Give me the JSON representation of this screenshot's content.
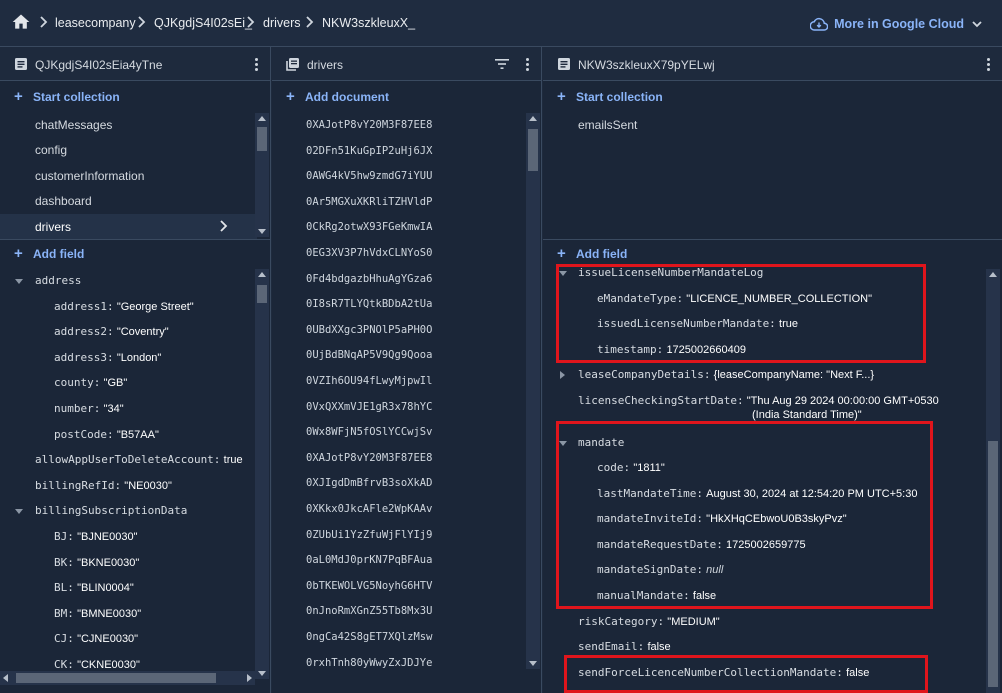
{
  "breadcrumb": {
    "items": [
      "leasecompany",
      "QJKgdjS4I02sEi_",
      "drivers",
      "NKW3szkleuxX_"
    ]
  },
  "header": {
    "more_cloud_label": "More in Google Cloud"
  },
  "col1": {
    "title": "QJKgdjS4I02sEia4yTne",
    "start_collection": "Start collection",
    "collections": [
      "chatMessages",
      "config",
      "customerInformation",
      "dashboard",
      "drivers"
    ],
    "add_field": "Add field",
    "fields": {
      "address": "address",
      "address1_k": "address1:",
      "address1_v": "\"George Street\"",
      "address2_k": "address2:",
      "address2_v": "\"Coventry\"",
      "address3_k": "address3:",
      "address3_v": "\"London\"",
      "county_k": "county:",
      "county_v": "\"GB\"",
      "number_k": "number:",
      "number_v": "\"34\"",
      "postCode_k": "postCode:",
      "postCode_v": "\"B57AA\"",
      "allow_k": "allowAppUserToDeleteAccount:",
      "allow_v": "true",
      "billingRefId_k": "billingRefId:",
      "billingRefId_v": "\"NE0030\"",
      "billingSub": "billingSubscriptionData",
      "BJ_k": "BJ:",
      "BJ_v": "\"BJNE0030\"",
      "BK_k": "BK:",
      "BK_v": "\"BKNE0030\"",
      "BL_k": "BL:",
      "BL_v": "\"BLIN0004\"",
      "BM_k": "BM:",
      "BM_v": "\"BMNE0030\"",
      "CJ_k": "CJ:",
      "CJ_v": "\"CJNE0030\"",
      "CK_k": "CK:",
      "CK_v": "\"CKNE0030\""
    }
  },
  "col2": {
    "title": "drivers",
    "add_document": "Add document",
    "docs": [
      "0XAJotP8vY20M3F87EE8",
      "02DFn51KuGpIP2uHj6JX",
      "0AWG4kV5hw9zmdG7iYUU",
      "0Ar5MGXuXKRliTZHVldP",
      "0CkRg2otwX93FGeKmwIA",
      "0EG3XV3P7hVdxCLNYoS0",
      "0Fd4bdgazbHhuAgYGza6",
      "0I8sR7TLYQtkBDbA2tUa",
      "0UBdXXgc3PNOlP5aPH0O",
      "0UjBdBNqAP5V9Qg9Qooa",
      "0VZIh6OU94fLwyMjpwIl",
      "0VxQXXmVJE1gR3x78hYC",
      "0Wx8WFjN5fOSlYCCwjSv",
      "0XAJotP8vY20M3F87EE8",
      "0XJIgdDmBfrvB3soXkAD",
      "0XKkx0JkcAFle2WpKAAv",
      "0ZUbUi1YzZfuWjFlYIj9",
      "0aL0MdJ0prKN7PqBFAua",
      "0bTKEWOLVG5NoyhG6HTV",
      "0nJnoRmXGnZ55Tb8Mx3U",
      "0ngCa42S8gET7XQlzMsw",
      "0rxhTnh80yWwyZxJDJYe"
    ]
  },
  "col3": {
    "title": "NKW3szkleuxX79pYELwj",
    "start_collection": "Start collection",
    "collections": [
      "emailsSent"
    ],
    "add_field": "Add field",
    "fields": {
      "issueLog": "issueLicenseNumberMandateLog",
      "eMandateType_k": "eMandateType:",
      "eMandateType_v": "\"LICENCE_NUMBER_COLLECTION\"",
      "issuedLic_k": "issuedLicenseNumberMandate:",
      "issuedLic_v": "true",
      "timestamp_k": "timestamp:",
      "timestamp_v": "1725002660409",
      "leaseCo_k": "leaseCompanyDetails:",
      "leaseCo_v": "{leaseCompanyName: \"Next F...}",
      "licStart_k": "licenseCheckingStartDate:",
      "licStart_v": "\"Thu Aug 29 2024 00:00:00 GMT+0530",
      "licStart_v2": "(India Standard Time)\"",
      "mandate": "mandate",
      "code_k": "code:",
      "code_v": "\"1811\"",
      "lastMandate_k": "lastMandateTime:",
      "lastMandate_v": "August 30, 2024 at 12:54:20 PM UTC+5:30",
      "invite_k": "mandateInviteId:",
      "invite_v": "\"HkXHqCEbwoU0B3skyPvz\"",
      "request_k": "mandateRequestDate:",
      "request_v": "1725002659775",
      "sign_k": "mandateSignDate:",
      "sign_v": "null",
      "manual_k": "manualMandate:",
      "manual_v": "false",
      "risk_k": "riskCategory:",
      "risk_v": "\"MEDIUM\"",
      "sendEmail_k": "sendEmail:",
      "sendEmail_v": "false",
      "sendForce_k": "sendForceLicenceNumberCollectionMandate:",
      "sendForce_v": "false"
    }
  },
  "colors": {
    "accent": "#8ab4f8",
    "highlight_box": "#e0151c",
    "background": "#1b2638"
  }
}
